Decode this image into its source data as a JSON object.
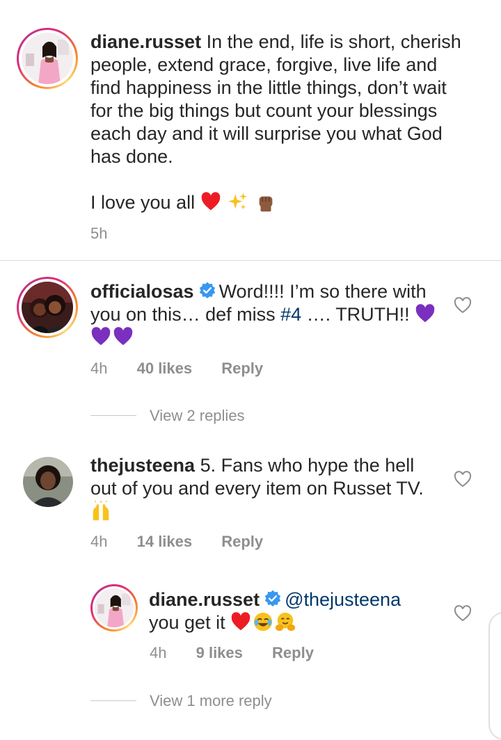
{
  "comments": [
    {
      "username": "diane.russet",
      "text": "In the end, life is short, cherish people, extend grace, forgive, live life and find happiness in the little things, don’t wait for the big things but count your blessings each day and it will surprise you what God has done.",
      "text2": "I love you all",
      "time": "5h"
    },
    {
      "username": "officialosas",
      "text_before": "Word!!!! I’m so there with you on this… def miss ",
      "hashtag": "#4",
      "text_after": " …. TRUTH!!",
      "time": "4h",
      "likes": "40 likes",
      "reply": "Reply",
      "view_replies": "View 2 replies"
    },
    {
      "username": "thejusteena",
      "text": "5. Fans who hype the hell out of you and every item on Russet TV.",
      "time": "4h",
      "likes": "14 likes",
      "reply": "Reply"
    },
    {
      "username": "diane.russet",
      "mention": "@thejusteena",
      "text": "you get it",
      "time": "4h",
      "likes": "9 likes",
      "reply": "Reply",
      "view_replies": "View 1 more reply"
    }
  ],
  "colors": {
    "text": "#262626",
    "meta": "#8e8e8e",
    "link": "#00376b",
    "verified": "#3897f0",
    "heart": "#ed1c24",
    "purple_heart": "#7b2fbe"
  },
  "icons": [
    "heart-outline-icon",
    "verified-badge-icon",
    "red-heart-emoji",
    "sparkles-emoji",
    "raised-fist-emoji",
    "purple-heart-emoji",
    "raising-hands-emoji",
    "joy-emoji",
    "hugging-emoji"
  ]
}
